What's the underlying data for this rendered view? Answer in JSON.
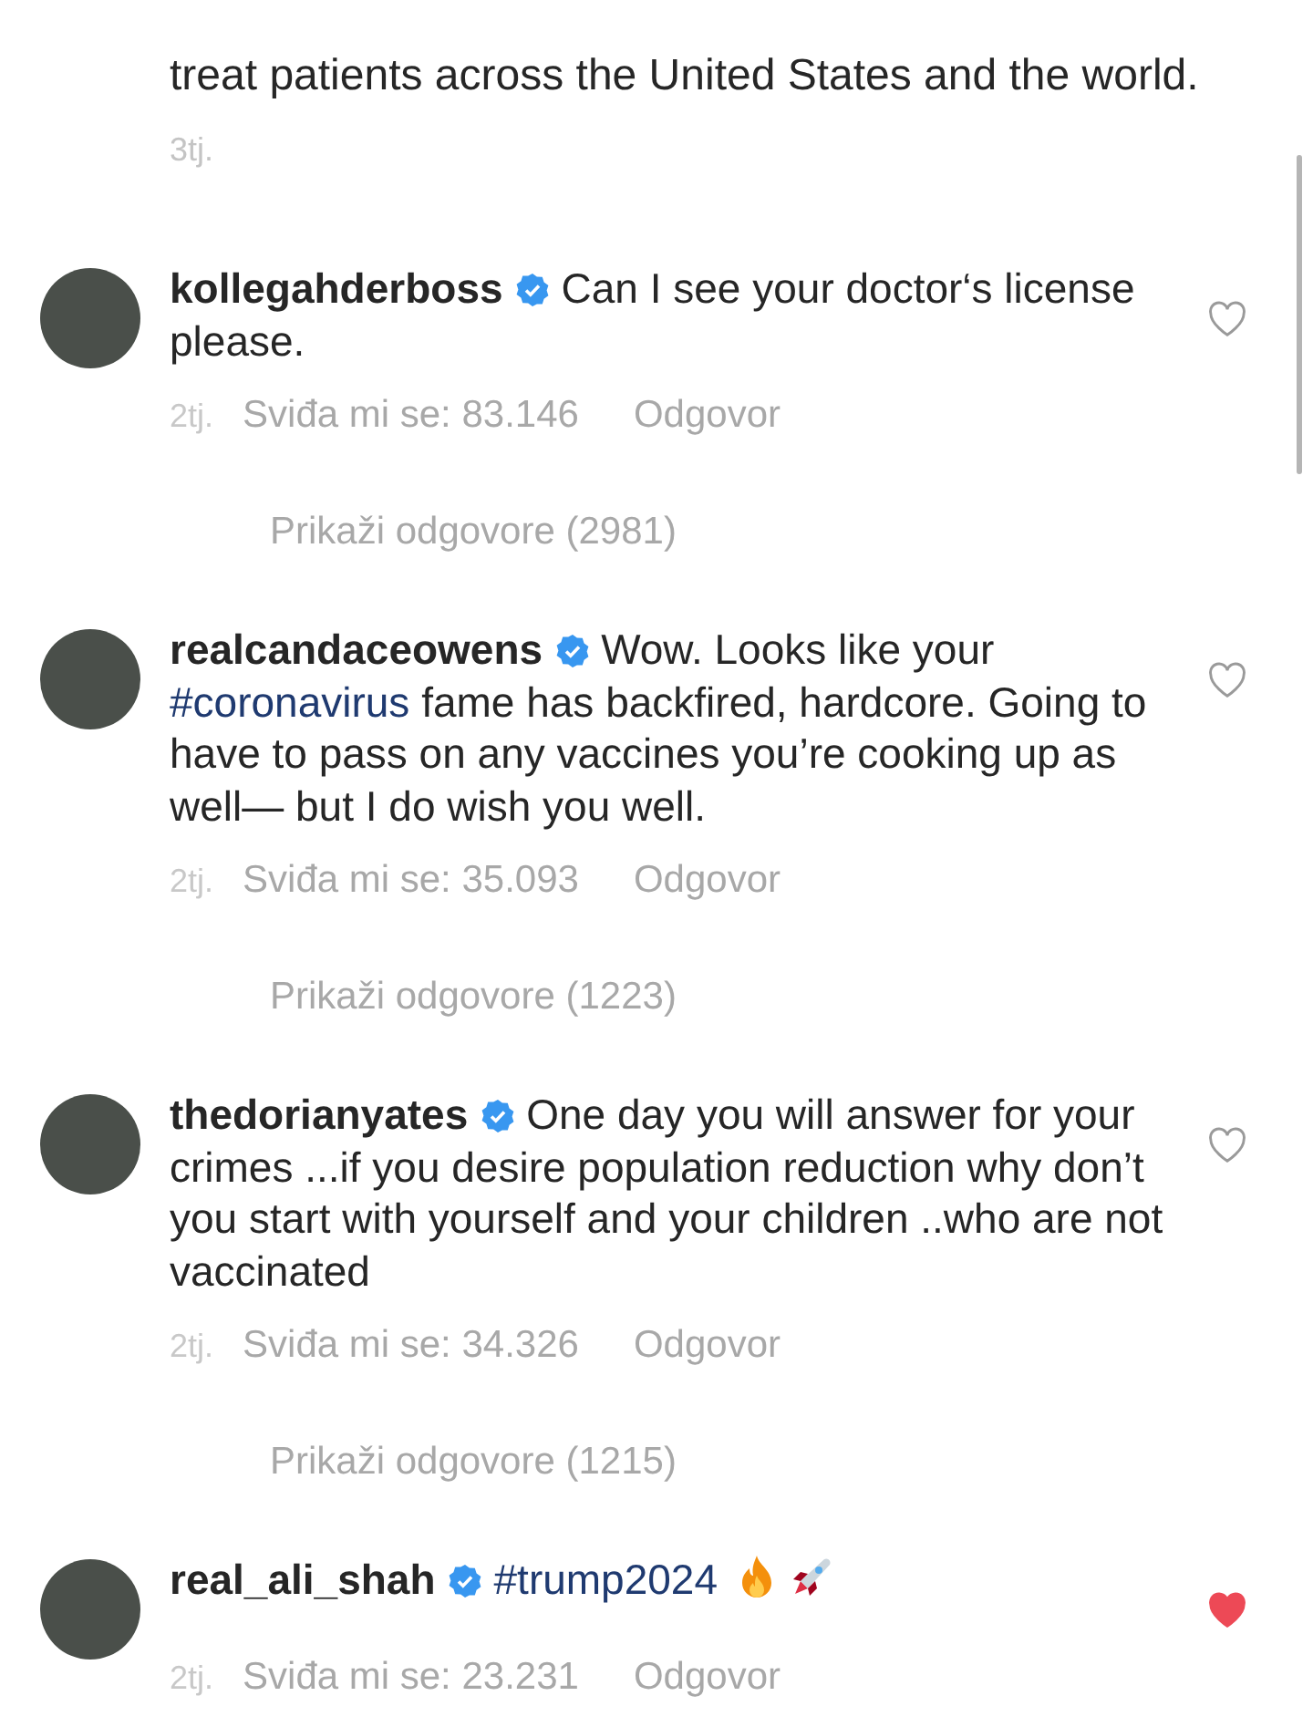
{
  "top_comment": {
    "text": "treat patients across the United States and the world.",
    "time": "3tj."
  },
  "comments": [
    {
      "username": "kollegahderboss",
      "verified": true,
      "body": [
        {
          "kind": "plain",
          "text": "Can I see your doctor‘s license please."
        }
      ],
      "time": "2tj.",
      "likes": "Sviđa mi se: 83.146",
      "reply": "Odgovor",
      "replies": "Prikaži odgovore (2981)",
      "liked": false
    },
    {
      "username": "realcandaceowens",
      "verified": true,
      "body": [
        {
          "kind": "plain",
          "text": "Wow. Looks like your "
        },
        {
          "kind": "hashtag",
          "text": "#coronavirus"
        },
        {
          "kind": "plain",
          "text": " fame has backfired, hardcore. Going to have to pass on any vaccines you’re cooking up as well— but I do wish you well."
        }
      ],
      "time": "2tj.",
      "likes": "Sviđa mi se: 35.093",
      "reply": "Odgovor",
      "replies": "Prikaži odgovore (1223)",
      "liked": false
    },
    {
      "username": "thedorianyates",
      "verified": true,
      "body": [
        {
          "kind": "plain",
          "text": "One day you will answer for your crimes ...if you desire population reduction why don’t you start with yourself and your children ..who are not vaccinated"
        }
      ],
      "time": "2tj.",
      "likes": "Sviđa mi se: 34.326",
      "reply": "Odgovor",
      "replies": "Prikaži odgovore (1215)",
      "liked": false
    },
    {
      "username": "real_ali_shah",
      "verified": true,
      "body": [
        {
          "kind": "hashtag",
          "text": "#trump2024"
        },
        {
          "kind": "fire"
        },
        {
          "kind": "rocket"
        }
      ],
      "time": "2tj.",
      "likes": "Sviđa mi se: 23.231",
      "reply": "Odgovor",
      "liked": true
    }
  ]
}
